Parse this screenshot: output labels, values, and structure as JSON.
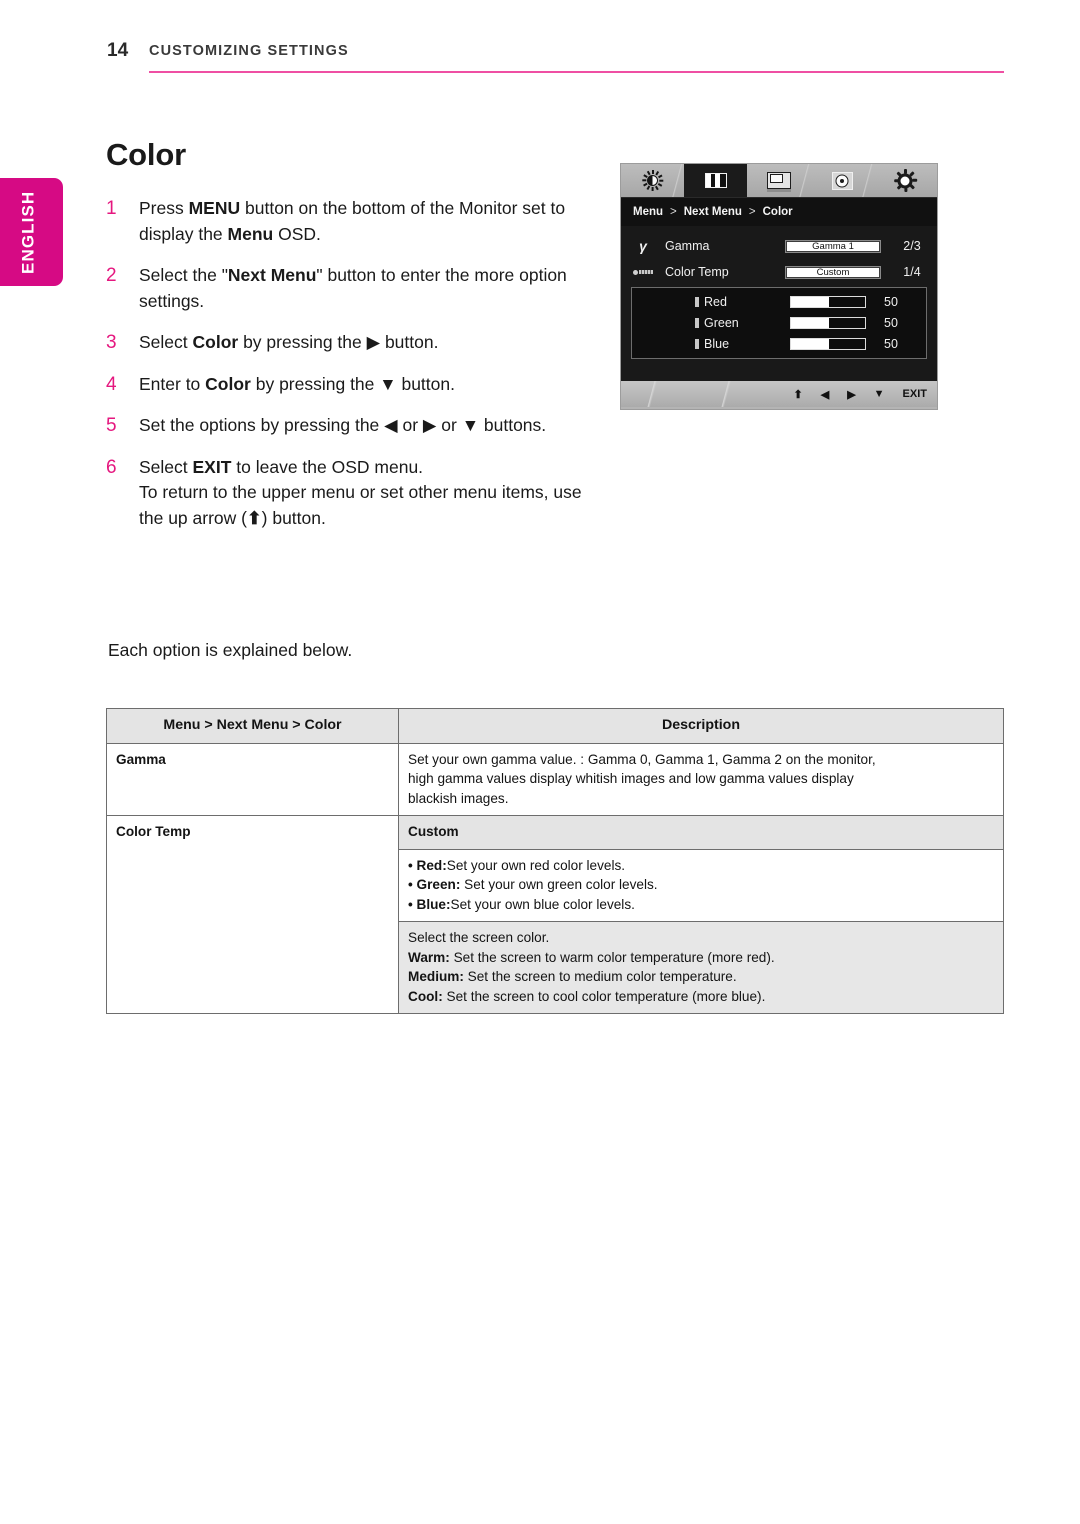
{
  "header": {
    "page_number": "14",
    "title": "CUSTOMIZING SETTINGS",
    "rule_color": "#ef4fa3"
  },
  "language_tab": {
    "label": "ENGLISH",
    "color": "#d60a84"
  },
  "section": {
    "title": "Color",
    "note": "Each option is explained below."
  },
  "steps": [
    {
      "num": "1",
      "parts": [
        {
          "t": "Press ",
          "b": false
        },
        {
          "t": "MENU",
          "b": true
        },
        {
          "t": " button on the bottom of the Monitor set to display the ",
          "b": false
        },
        {
          "t": "Menu",
          "b": true
        },
        {
          "t": " OSD.",
          "b": false
        }
      ]
    },
    {
      "num": "2",
      "parts": [
        {
          "t": "Select the \"",
          "b": false
        },
        {
          "t": "Next Menu",
          "b": true
        },
        {
          "t": "\" button to enter the more option settings.",
          "b": false
        }
      ]
    },
    {
      "num": "3",
      "parts": [
        {
          "t": "Select ",
          "b": false
        },
        {
          "t": "Color",
          "b": true
        },
        {
          "t": " by pressing the ",
          "b": false
        },
        {
          "t": "▶",
          "b": false
        },
        {
          "t": " button.",
          "b": false
        }
      ]
    },
    {
      "num": "4",
      "parts": [
        {
          "t": "Enter to ",
          "b": false
        },
        {
          "t": "Color",
          "b": true
        },
        {
          "t": " by pressing the ",
          "b": false
        },
        {
          "t": "▼",
          "b": false
        },
        {
          "t": " button.",
          "b": false
        }
      ]
    },
    {
      "num": "5",
      "parts": [
        {
          "t": "Set the options by pressing the ",
          "b": false
        },
        {
          "t": "◀",
          "b": false
        },
        {
          "t": " or ",
          "b": false
        },
        {
          "t": "▶",
          "b": false
        },
        {
          "t": " or ",
          "b": false
        },
        {
          "t": "▼",
          "b": false
        },
        {
          "t": " buttons.",
          "b": false
        }
      ]
    },
    {
      "num": "6",
      "parts": [
        {
          "t": "Select ",
          "b": false
        },
        {
          "t": "EXIT",
          "b": true
        },
        {
          "t": " to leave the OSD menu.",
          "b": false
        }
      ],
      "sub_parts": [
        {
          "t": "To return to the upper menu or set other menu items, use the up arrow (",
          "b": false
        },
        {
          "t": "⬆",
          "b": true
        },
        {
          "t": ") button.",
          "b": false
        }
      ]
    }
  ],
  "osd": {
    "icon_tabs": [
      {
        "name": "brightness-icon",
        "selected": false
      },
      {
        "name": "contrast-icon",
        "selected": true
      },
      {
        "name": "screen-icon",
        "selected": false
      },
      {
        "name": "disc-icon",
        "selected": false
      },
      {
        "name": "gear-icon",
        "selected": false
      }
    ],
    "breadcrumb": {
      "root": "Menu",
      "sep1": ">",
      "mid": "Next Menu",
      "sep2": ">",
      "leaf": "Color"
    },
    "rows": [
      {
        "icon": "gamma-icon",
        "label": "Gamma",
        "value": "Gamma 1",
        "index": "2/3"
      },
      {
        "icon": "color-temp-icon",
        "label": "Color Temp",
        "value": "Custom",
        "index": "1/4"
      }
    ],
    "rgb": [
      {
        "label": "Red",
        "value": "50",
        "fill_pct": 52
      },
      {
        "label": "Green",
        "value": "50",
        "fill_pct": 52
      },
      {
        "label": "Blue",
        "value": "50",
        "fill_pct": 52
      }
    ],
    "footer": {
      "up": "⬆",
      "left": "◀",
      "right": "▶",
      "down": "▼",
      "exit": "EXIT"
    }
  },
  "table": {
    "headers": [
      "Menu > Next Menu > Color",
      "Description"
    ],
    "rows": [
      {
        "key": "Gamma",
        "desc_lines": [
          "Set your own gamma value. : Gamma 0, Gamma 1, Gamma 2 on the monitor,",
          "high gamma values display whitish images and low gamma values display",
          "blackish images."
        ]
      },
      {
        "key": "Color Temp",
        "sub_header": "Custom",
        "bullets": [
          {
            "bold": "• Red:",
            "rest": "Set your own red color levels."
          },
          {
            "bold": "• Green:",
            "rest": " Set your own green color levels."
          },
          {
            "bold": "• Blue:",
            "rest": "Set your own blue color levels."
          }
        ],
        "screen_color": {
          "intro": "Select the screen color.",
          "lines": [
            {
              "bold": "Warm:",
              "rest": " Set the screen to warm color temperature (more red)."
            },
            {
              "bold": "Medium:",
              "rest": " Set the screen to medium color temperature."
            },
            {
              "bold": "Cool:",
              "rest": " Set the screen to cool color temperature (more blue)."
            }
          ]
        }
      }
    ]
  }
}
